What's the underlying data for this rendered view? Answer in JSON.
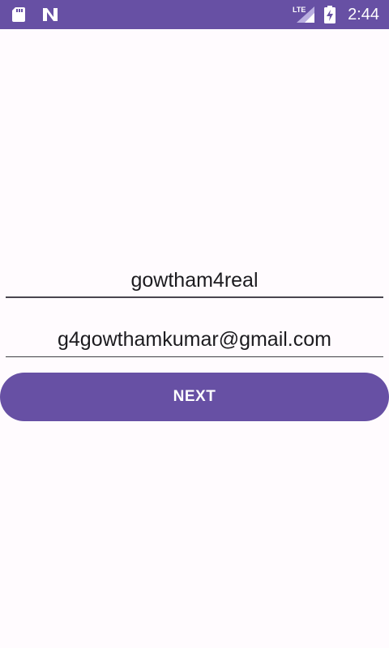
{
  "status_bar": {
    "time": "2:44",
    "network_label": "LTE",
    "icons": [
      "sd-card-icon",
      "n-notification-icon",
      "lte-signal-icon",
      "battery-charging-icon"
    ]
  },
  "form": {
    "username_value": "gowtham4real",
    "email_value": "g4gowthamkumar@gmail.com"
  },
  "actions": {
    "next_label": "NEXT"
  },
  "colors": {
    "primary": "#6750a4",
    "background": "#fffbfe",
    "text": "#1c1b1f"
  }
}
